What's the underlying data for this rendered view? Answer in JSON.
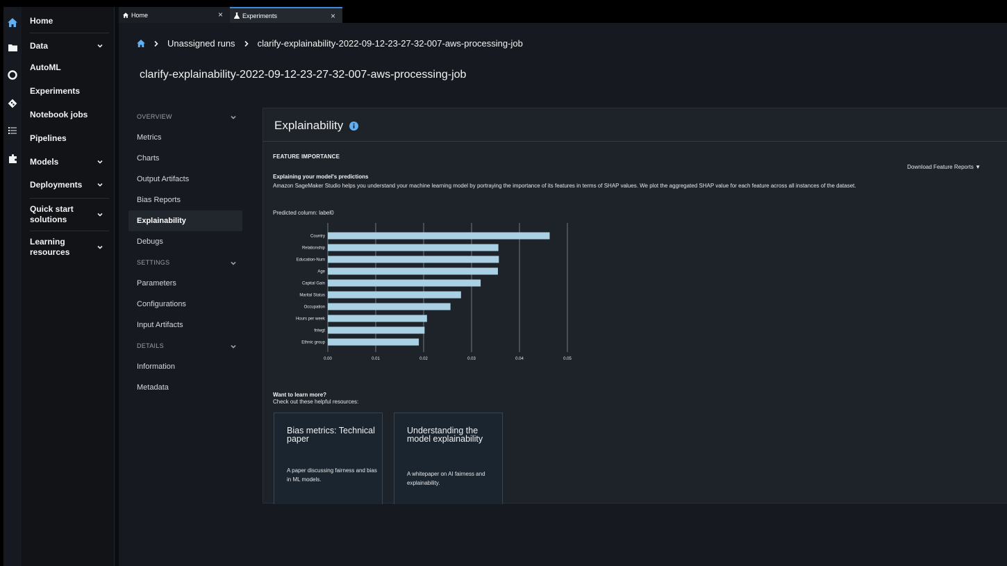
{
  "activity_bar": {
    "icons": [
      "home-icon",
      "folder-icon",
      "running-icon",
      "git-icon",
      "list-icon",
      "extension-icon"
    ]
  },
  "left_nav": {
    "items": [
      {
        "label": "Home"
      },
      {
        "label": "Data"
      },
      {
        "label": "AutoML"
      },
      {
        "label": "Experiments"
      },
      {
        "label": "Notebook jobs"
      },
      {
        "label": "Pipelines"
      },
      {
        "label": "Models"
      },
      {
        "label": "Deployments"
      },
      {
        "label": "Quick start solutions"
      },
      {
        "label": "Learning resources"
      }
    ]
  },
  "tabs": [
    {
      "label": "Home",
      "close": "×"
    },
    {
      "label": "Experiments",
      "close": "×"
    }
  ],
  "breadcrumb": {
    "items": [
      "Unassigned runs",
      "clarify-explainability-2022-09-12-23-27-32-007-aws-processing-job"
    ]
  },
  "page": {
    "title": "clarify-explainability-2022-09-12-23-27-32-007-aws-processing-job"
  },
  "sub_nav": {
    "items": [
      {
        "label": "OVERVIEW"
      },
      {
        "label": "Metrics"
      },
      {
        "label": "Charts"
      },
      {
        "label": "Output Artifacts"
      },
      {
        "label": "Bias Reports"
      },
      {
        "label": "Explainability"
      },
      {
        "label": "Debugs"
      },
      {
        "label": "SETTINGS"
      },
      {
        "label": "Parameters"
      },
      {
        "label": "Configurations"
      },
      {
        "label": "Input Artifacts"
      },
      {
        "label": "DETAILS"
      },
      {
        "label": "Information"
      },
      {
        "label": "Metadata"
      }
    ]
  },
  "panel": {
    "title": "Explainability",
    "feature_heading": "FEATURE IMPORTANCE",
    "download_label": "Download Feature Reports ▼",
    "explain_title": "Explaining your model's predictions",
    "explain_desc": "Amazon SageMaker Studio helps you understand your machine learning model by portraying the importance of its features in terms of SHAP values. We plot the aggregated SHAP value for each feature across all instances of the dataset.",
    "predicted_column": "Predicted column: label0",
    "learn_title": "Want to learn more?",
    "learn_sub": "Check out these helpful resources:",
    "cards": [
      {
        "title": "Bias metrics: Technical paper",
        "desc": "A paper discussing fairness and bias in ML models."
      },
      {
        "title": "Understanding the model explainability",
        "desc": "A whitepaper on AI fairness and explainability."
      }
    ]
  },
  "colors": {
    "bar": "#a9d0e3",
    "accent": "#3b8be8",
    "background": "#16191f"
  },
  "chart_data": {
    "type": "bar",
    "orientation": "horizontal",
    "categories": [
      "Country",
      "Relationship",
      "Education-Num",
      "Age",
      "Capital Gain",
      "Marital Status",
      "Occupation",
      "Hours per week",
      "fnlwgt",
      "Ethnic group"
    ],
    "values": [
      0.0463,
      0.0356,
      0.0357,
      0.0355,
      0.0319,
      0.0278,
      0.0256,
      0.0207,
      0.0202,
      0.019
    ],
    "x_ticks": [
      "0.00",
      "0.01",
      "0.02",
      "0.03",
      "0.04",
      "0.05"
    ],
    "xlim": [
      0,
      0.05
    ],
    "grid": "vertical"
  }
}
